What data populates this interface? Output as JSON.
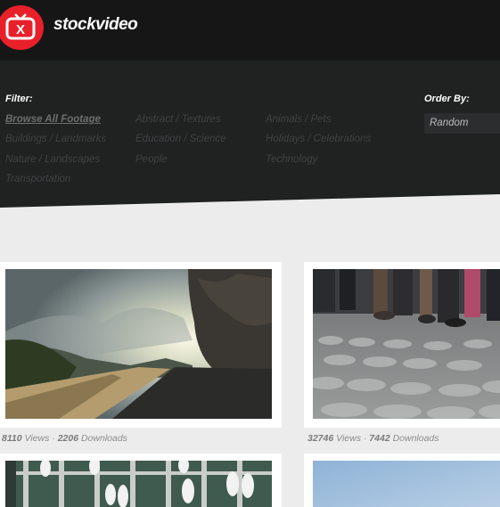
{
  "brand": {
    "name": "stockvideo",
    "logo_letter": "X"
  },
  "filter": {
    "heading": "Filter:",
    "categories": [
      {
        "label": "Browse All Footage",
        "active": true
      },
      {
        "label": "Abstract / Textures",
        "active": false
      },
      {
        "label": "Animals / Pets",
        "active": false
      },
      {
        "label": "Buildings / Landmarks",
        "active": false
      },
      {
        "label": "Education / Science",
        "active": false
      },
      {
        "label": "Holidays / Celebrations",
        "active": false
      },
      {
        "label": "Nature / Landscapes",
        "active": false
      },
      {
        "label": "People",
        "active": false
      },
      {
        "label": "Technology",
        "active": false
      },
      {
        "label": "Transportation",
        "active": false
      }
    ]
  },
  "order_by": {
    "heading": "Order By:",
    "selected": "Random"
  },
  "videos": [
    {
      "views": "8110",
      "downloads": "2206",
      "views_label": "Views",
      "separator": "·",
      "downloads_label": "Downloads",
      "thumb": "cliff-road-sunset"
    },
    {
      "views": "32746",
      "downloads": "7442",
      "views_label": "Views",
      "separator": "·",
      "downloads_label": "Downloads",
      "thumb": "cobblestone-walkers"
    },
    {
      "thumb": "marina-boats-aerial"
    },
    {
      "thumb": "blue-sky"
    }
  ],
  "colors": {
    "accent": "#e8202a",
    "topbar": "#161616",
    "filter_panel": "#202121"
  }
}
